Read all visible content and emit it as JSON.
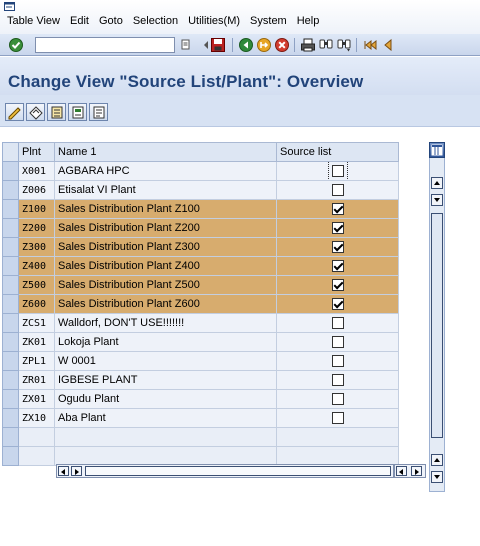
{
  "menubar": {
    "items": [
      "Table View",
      "Edit",
      "Goto",
      "Selection",
      "Utilities(M)",
      "System",
      "Help"
    ]
  },
  "toolbar": {
    "command_field_value": "",
    "icons": [
      "enter-icon",
      "save-icon",
      "back-icon",
      "exit-icon",
      "cancel-icon",
      "print-icon",
      "find-icon",
      "find-next-icon",
      "first-page-icon",
      "previous-page-icon"
    ]
  },
  "title": {
    "text": "Change View \"Source List/Plant\": Overview"
  },
  "app_toolbar": {
    "icons": [
      "new-entries-icon",
      "copy-as-icon",
      "delete-icon",
      "undo-change-icon",
      "select-all-icon"
    ]
  },
  "table": {
    "columns": [
      "Plnt",
      "Name 1",
      "Source list"
    ],
    "rows": [
      {
        "plant": "X001",
        "name": "AGBARA HPC",
        "source_list": false,
        "highlighted": false
      },
      {
        "plant": "Z006",
        "name": "Etisalat VI Plant",
        "source_list": false,
        "highlighted": false
      },
      {
        "plant": "Z100",
        "name": "Sales Distribution Plant Z100",
        "source_list": true,
        "highlighted": true
      },
      {
        "plant": "Z200",
        "name": "Sales Distribution Plant Z200",
        "source_list": true,
        "highlighted": true
      },
      {
        "plant": "Z300",
        "name": "Sales Distribution Plant Z300",
        "source_list": true,
        "highlighted": true
      },
      {
        "plant": "Z400",
        "name": "Sales Distribution Plant Z400",
        "source_list": true,
        "highlighted": true
      },
      {
        "plant": "Z500",
        "name": "Sales Distribution Plant Z500",
        "source_list": true,
        "highlighted": true
      },
      {
        "plant": "Z600",
        "name": "Sales Distribution Plant Z600",
        "source_list": true,
        "highlighted": true
      },
      {
        "plant": "ZCS1",
        "name": "Walldorf, DON'T USE!!!!!!!",
        "source_list": false,
        "highlighted": false
      },
      {
        "plant": "ZK01",
        "name": "Lokoja Plant",
        "source_list": false,
        "highlighted": false
      },
      {
        "plant": "ZPL1",
        "name": "W 0001",
        "source_list": false,
        "highlighted": false
      },
      {
        "plant": "ZR01",
        "name": "IGBESE PLANT",
        "source_list": false,
        "highlighted": false
      },
      {
        "plant": "ZX01",
        "name": "Ogudu Plant",
        "source_list": false,
        "highlighted": false
      },
      {
        "plant": "ZX10",
        "name": "Aba Plant",
        "source_list": false,
        "highlighted": false
      }
    ],
    "empty_rows": 2
  },
  "colors": {
    "highlight_row": "#d7ac6e",
    "title_text": "#22447a",
    "toolbar_bg": "#c9d6ec"
  }
}
